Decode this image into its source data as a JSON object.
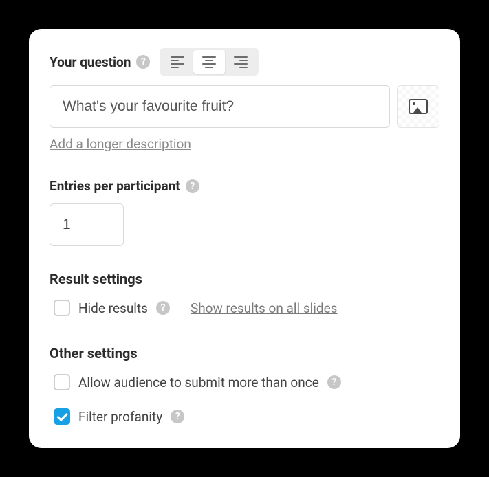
{
  "question": {
    "label": "Your question",
    "value": "What's your favourite fruit?",
    "add_description": "Add a longer description"
  },
  "entries": {
    "label": "Entries per participant",
    "value": "1"
  },
  "result": {
    "title": "Result settings",
    "hide_label": "Hide results",
    "show_all_label": "Show results on all slides"
  },
  "other": {
    "title": "Other settings",
    "allow_multi_label": "Allow audience to submit more than once",
    "filter_label": "Filter profanity"
  }
}
